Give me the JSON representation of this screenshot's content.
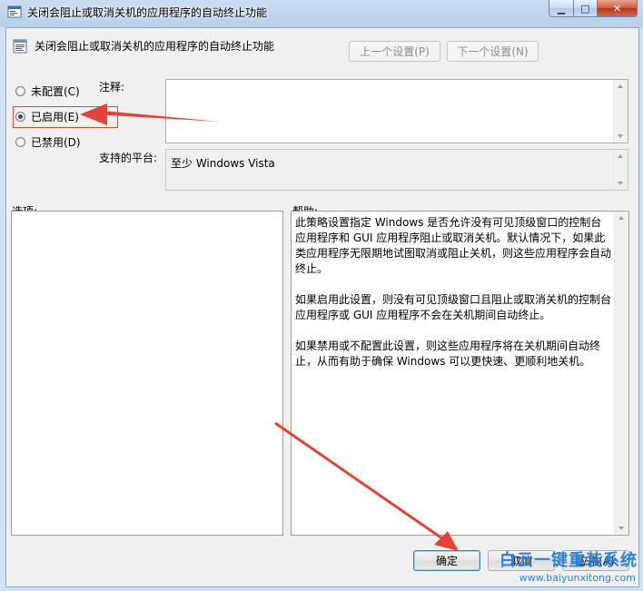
{
  "window": {
    "title": "关闭会阻止或取消关机的应用程序的自动终止功能",
    "minimize_glyph": "▁",
    "maximize_glyph": "□",
    "close_glyph": "✕"
  },
  "header": {
    "policy_title": "关闭会阻止或取消关机的应用程序的自动终止功能",
    "prev_setting": "上一个设置(P)",
    "next_setting": "下一个设置(N)"
  },
  "state": {
    "options": [
      {
        "label": "未配置(C)",
        "checked": false
      },
      {
        "label": "已启用(E)",
        "checked": true
      },
      {
        "label": "已禁用(D)",
        "checked": false
      }
    ]
  },
  "comment": {
    "label": "注释:",
    "value": ""
  },
  "platform": {
    "label": "支持的平台:",
    "value": "至少 Windows Vista"
  },
  "options_section": {
    "label": "选项:"
  },
  "help_section": {
    "label": "帮助:",
    "paragraphs": [
      "此策略设置指定 Windows 是否允许没有可见顶级窗口的控制台应用程序和 GUI 应用程序阻止或取消关机。默认情况下，如果此类应用程序无限期地试图取消或阻止关机，则这些应用程序会自动终止。",
      "如果启用此设置，则没有可见顶级窗口且阻止或取消关机的控制台应用程序或 GUI 应用程序不会在关机期间自动终止。",
      "如果禁用或不配置此设置，则这些应用程序将在关机期间自动终止，从而有助于确保 Windows 可以更快速、更顺利地关机。"
    ]
  },
  "footer": {
    "ok": "确定",
    "cancel": "取消",
    "apply": "应用(A)"
  },
  "watermark": {
    "brand": "白云一键重装系统",
    "url": "www.baiyunxitong.com"
  },
  "colors": {
    "annotation_red": "#e2443a",
    "watermark_blue": "#2b83d8"
  }
}
